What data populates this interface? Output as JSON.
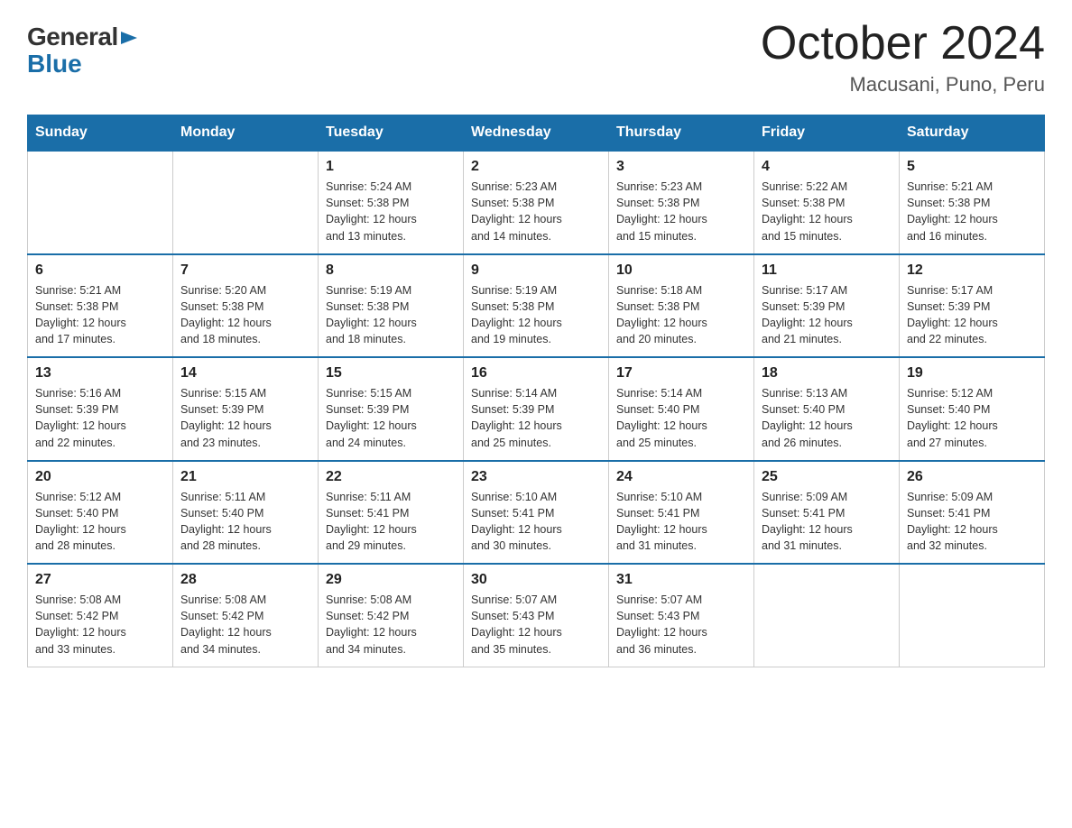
{
  "logo": {
    "general": "General",
    "blue": "Blue"
  },
  "title": "October 2024",
  "subtitle": "Macusani, Puno, Peru",
  "header": {
    "days": [
      "Sunday",
      "Monday",
      "Tuesday",
      "Wednesday",
      "Thursday",
      "Friday",
      "Saturday"
    ]
  },
  "weeks": [
    {
      "days": [
        {
          "num": "",
          "info": ""
        },
        {
          "num": "",
          "info": ""
        },
        {
          "num": "1",
          "info": "Sunrise: 5:24 AM\nSunset: 5:38 PM\nDaylight: 12 hours\nand 13 minutes."
        },
        {
          "num": "2",
          "info": "Sunrise: 5:23 AM\nSunset: 5:38 PM\nDaylight: 12 hours\nand 14 minutes."
        },
        {
          "num": "3",
          "info": "Sunrise: 5:23 AM\nSunset: 5:38 PM\nDaylight: 12 hours\nand 15 minutes."
        },
        {
          "num": "4",
          "info": "Sunrise: 5:22 AM\nSunset: 5:38 PM\nDaylight: 12 hours\nand 15 minutes."
        },
        {
          "num": "5",
          "info": "Sunrise: 5:21 AM\nSunset: 5:38 PM\nDaylight: 12 hours\nand 16 minutes."
        }
      ]
    },
    {
      "days": [
        {
          "num": "6",
          "info": "Sunrise: 5:21 AM\nSunset: 5:38 PM\nDaylight: 12 hours\nand 17 minutes."
        },
        {
          "num": "7",
          "info": "Sunrise: 5:20 AM\nSunset: 5:38 PM\nDaylight: 12 hours\nand 18 minutes."
        },
        {
          "num": "8",
          "info": "Sunrise: 5:19 AM\nSunset: 5:38 PM\nDaylight: 12 hours\nand 18 minutes."
        },
        {
          "num": "9",
          "info": "Sunrise: 5:19 AM\nSunset: 5:38 PM\nDaylight: 12 hours\nand 19 minutes."
        },
        {
          "num": "10",
          "info": "Sunrise: 5:18 AM\nSunset: 5:38 PM\nDaylight: 12 hours\nand 20 minutes."
        },
        {
          "num": "11",
          "info": "Sunrise: 5:17 AM\nSunset: 5:39 PM\nDaylight: 12 hours\nand 21 minutes."
        },
        {
          "num": "12",
          "info": "Sunrise: 5:17 AM\nSunset: 5:39 PM\nDaylight: 12 hours\nand 22 minutes."
        }
      ]
    },
    {
      "days": [
        {
          "num": "13",
          "info": "Sunrise: 5:16 AM\nSunset: 5:39 PM\nDaylight: 12 hours\nand 22 minutes."
        },
        {
          "num": "14",
          "info": "Sunrise: 5:15 AM\nSunset: 5:39 PM\nDaylight: 12 hours\nand 23 minutes."
        },
        {
          "num": "15",
          "info": "Sunrise: 5:15 AM\nSunset: 5:39 PM\nDaylight: 12 hours\nand 24 minutes."
        },
        {
          "num": "16",
          "info": "Sunrise: 5:14 AM\nSunset: 5:39 PM\nDaylight: 12 hours\nand 25 minutes."
        },
        {
          "num": "17",
          "info": "Sunrise: 5:14 AM\nSunset: 5:40 PM\nDaylight: 12 hours\nand 25 minutes."
        },
        {
          "num": "18",
          "info": "Sunrise: 5:13 AM\nSunset: 5:40 PM\nDaylight: 12 hours\nand 26 minutes."
        },
        {
          "num": "19",
          "info": "Sunrise: 5:12 AM\nSunset: 5:40 PM\nDaylight: 12 hours\nand 27 minutes."
        }
      ]
    },
    {
      "days": [
        {
          "num": "20",
          "info": "Sunrise: 5:12 AM\nSunset: 5:40 PM\nDaylight: 12 hours\nand 28 minutes."
        },
        {
          "num": "21",
          "info": "Sunrise: 5:11 AM\nSunset: 5:40 PM\nDaylight: 12 hours\nand 28 minutes."
        },
        {
          "num": "22",
          "info": "Sunrise: 5:11 AM\nSunset: 5:41 PM\nDaylight: 12 hours\nand 29 minutes."
        },
        {
          "num": "23",
          "info": "Sunrise: 5:10 AM\nSunset: 5:41 PM\nDaylight: 12 hours\nand 30 minutes."
        },
        {
          "num": "24",
          "info": "Sunrise: 5:10 AM\nSunset: 5:41 PM\nDaylight: 12 hours\nand 31 minutes."
        },
        {
          "num": "25",
          "info": "Sunrise: 5:09 AM\nSunset: 5:41 PM\nDaylight: 12 hours\nand 31 minutes."
        },
        {
          "num": "26",
          "info": "Sunrise: 5:09 AM\nSunset: 5:41 PM\nDaylight: 12 hours\nand 32 minutes."
        }
      ]
    },
    {
      "days": [
        {
          "num": "27",
          "info": "Sunrise: 5:08 AM\nSunset: 5:42 PM\nDaylight: 12 hours\nand 33 minutes."
        },
        {
          "num": "28",
          "info": "Sunrise: 5:08 AM\nSunset: 5:42 PM\nDaylight: 12 hours\nand 34 minutes."
        },
        {
          "num": "29",
          "info": "Sunrise: 5:08 AM\nSunset: 5:42 PM\nDaylight: 12 hours\nand 34 minutes."
        },
        {
          "num": "30",
          "info": "Sunrise: 5:07 AM\nSunset: 5:43 PM\nDaylight: 12 hours\nand 35 minutes."
        },
        {
          "num": "31",
          "info": "Sunrise: 5:07 AM\nSunset: 5:43 PM\nDaylight: 12 hours\nand 36 minutes."
        },
        {
          "num": "",
          "info": ""
        },
        {
          "num": "",
          "info": ""
        }
      ]
    }
  ]
}
